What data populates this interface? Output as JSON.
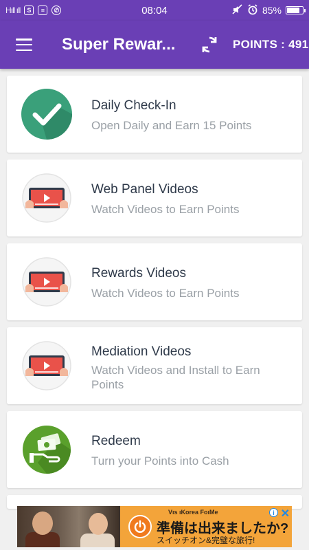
{
  "status_bar": {
    "signal_text": "Hıll ıll",
    "time": "08:04",
    "battery": "85%",
    "battery_level": 0.85,
    "icons": [
      "s-icon",
      "message-icon",
      "whatsapp-icon",
      "mute-icon",
      "alarm-icon"
    ]
  },
  "app_bar": {
    "title": "Super Rewar...",
    "points_label": "POINTS : 491"
  },
  "items": [
    {
      "title": "Daily Check-In",
      "subtitle": "Open Daily and Earn 15 Points",
      "icon": "check-icon"
    },
    {
      "title": "Web Panel Videos",
      "subtitle": "Watch Videos to Earn Points",
      "icon": "video-tablet-icon"
    },
    {
      "title": "Rewards Videos",
      "subtitle": "Watch Videos to Earn Points",
      "icon": "video-tablet-icon"
    },
    {
      "title": "Mediation Videos",
      "subtitle": "Watch Videos and Install to Earn Points",
      "icon": "video-tablet-icon"
    },
    {
      "title": "Redeem",
      "subtitle": "Turn your Points into Cash",
      "icon": "cash-icon"
    }
  ],
  "ad": {
    "brand": "Vıs ıKorea FoıMe",
    "headline": "準備は出来ましたか?",
    "small_text": "スイッチオン&完璧な旅行!",
    "info_glyph": "i",
    "close_glyph": "✕"
  },
  "colors": {
    "primary": "#6a3fb5",
    "check_green": "#3aa07a",
    "redeem_green": "#5aa02c",
    "video_red": "#e9524a",
    "ad_orange": "#f3a43a"
  }
}
